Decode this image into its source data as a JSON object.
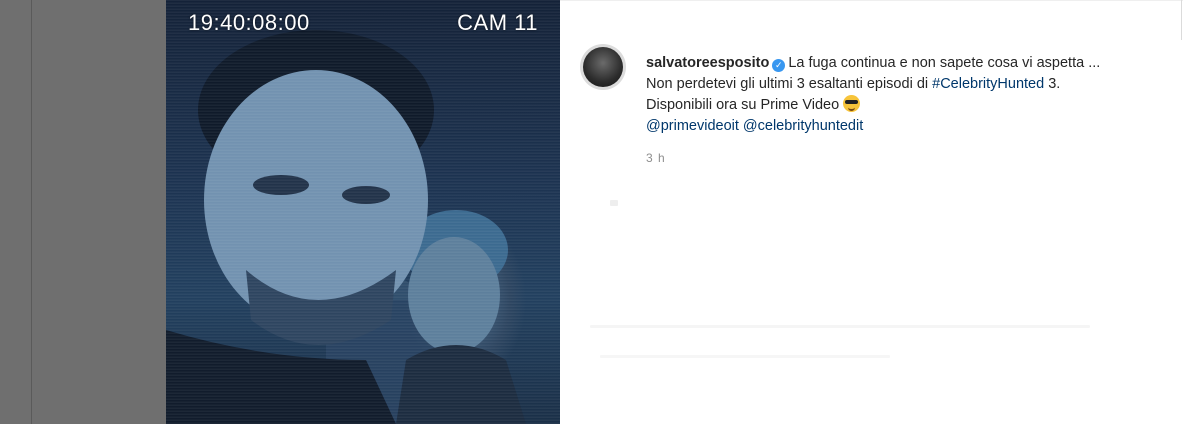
{
  "photo": {
    "timestamp": "19:40:08:00",
    "camera": "CAM 11"
  },
  "post": {
    "username": "salvatoreesposito",
    "caption_part1": "La fuga continua e non sapete cosa vi aspetta ... Non perdetevi gli ultimi 3 esaltanti episodi di ",
    "hashtag": "#CelebrityHunted",
    "caption_part2": " 3. Disponibili ora su Prime Video ",
    "mention1": "@primevideoit",
    "mention2": "@celebrityhuntedit",
    "time": "3 h"
  },
  "colors": {
    "link": "#00376b",
    "verified": "#3897f0",
    "text": "#262626",
    "muted": "#8e8e8e"
  },
  "icons": {
    "verified": "verified-badge-icon",
    "emoji": "sunglasses-emoji-icon"
  }
}
